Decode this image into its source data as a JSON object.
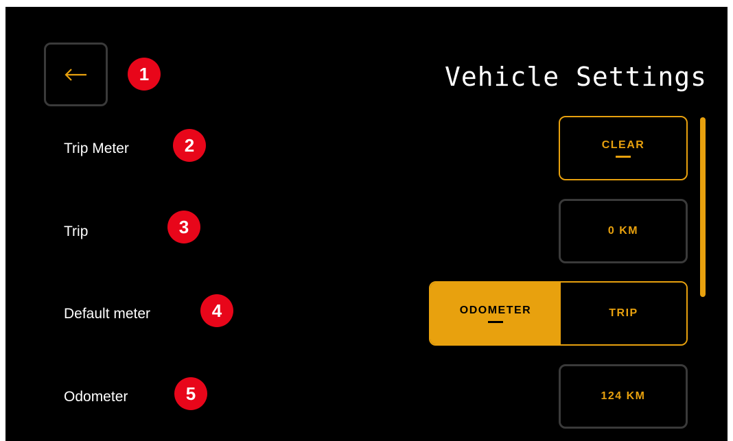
{
  "header": {
    "title": "Vehicle Settings",
    "back_icon": "arrow-left-icon"
  },
  "colors": {
    "accent": "#e8a10e",
    "background": "#000000",
    "badge": "#e8061a",
    "border_inactive": "#3a3a3a"
  },
  "badges": [
    "1",
    "2",
    "3",
    "4",
    "5"
  ],
  "rows": {
    "trip_meter": {
      "label": "Trip Meter",
      "button": "CLEAR"
    },
    "trip": {
      "label": "Trip",
      "value": "0 KM"
    },
    "default_meter": {
      "label": "Default meter",
      "options": [
        "ODOMETER",
        "TRIP"
      ],
      "selected": "ODOMETER"
    },
    "odometer": {
      "label": "Odometer",
      "value": "124 KM"
    }
  }
}
